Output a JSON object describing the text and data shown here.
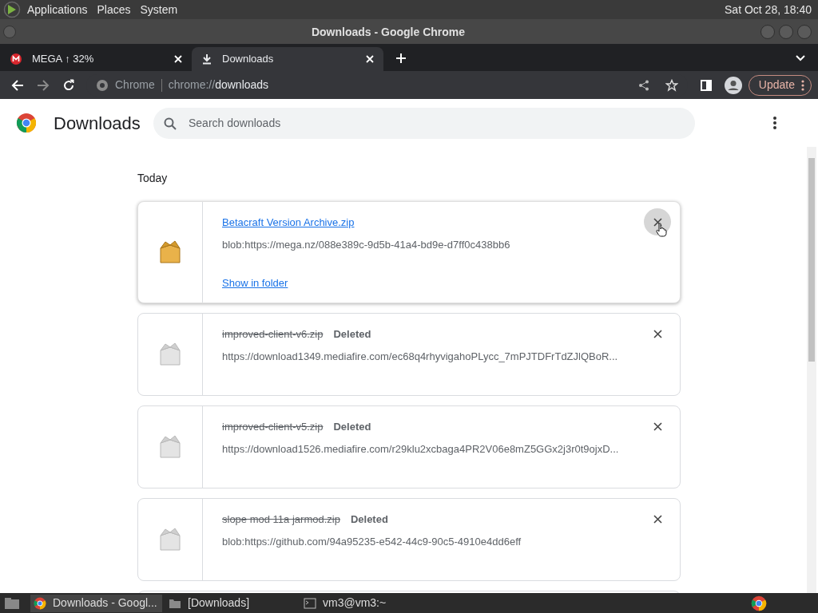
{
  "top_panel": {
    "menus": [
      "Applications",
      "Places",
      "System"
    ],
    "clock": "Sat Oct 28, 18:40"
  },
  "window": {
    "title": "Downloads - Google Chrome"
  },
  "tabs": [
    {
      "label": "MEGA ↑ 32%",
      "kind": "mega",
      "selected": false
    },
    {
      "label": "Downloads",
      "kind": "download",
      "selected": true
    }
  ],
  "toolbar": {
    "site_label": "Chrome",
    "url_scheme": "chrome://",
    "url_path": "downloads",
    "update_button": "Update"
  },
  "page": {
    "title": "Downloads",
    "search": {
      "placeholder": "Search downloads"
    },
    "section": "Today"
  },
  "downloads": [
    {
      "file_name": "Betacraft Version Archive.zip",
      "deleted": false,
      "hovered": true,
      "url": "blob:https://mega.nz/088e389c-9d5b-41a4-bd9e-d7ff0c438bb6",
      "action": "Show in folder"
    },
    {
      "file_name": "improved-client-v6.zip",
      "deleted": true,
      "hovered": false,
      "status": "Deleted",
      "url": "https://download1349.mediafire.com/ec68q4rhyvigahoPLycc_7mPJTDFrTdZJlQBoR..."
    },
    {
      "file_name": "improved-client-v5.zip",
      "deleted": true,
      "hovered": false,
      "status": "Deleted",
      "url": "https://download1526.mediafire.com/r29klu2xcbaga4PR2V06e8mZ5GGx2j3r0t9ojxD..."
    },
    {
      "file_name": "slope mod 11a jarmod.zip",
      "deleted": true,
      "hovered": false,
      "status": "Deleted",
      "url": "blob:https://github.com/94a95235-e542-44c9-90c5-4910e4dd6eff"
    }
  ],
  "taskbar": [
    {
      "label": "Downloads - Googl...",
      "kind": "chrome",
      "selected": true
    },
    {
      "label": "[Downloads]",
      "kind": "folder",
      "selected": false
    },
    {
      "label": "vm3@vm3:~",
      "kind": "terminal",
      "selected": false
    }
  ]
}
